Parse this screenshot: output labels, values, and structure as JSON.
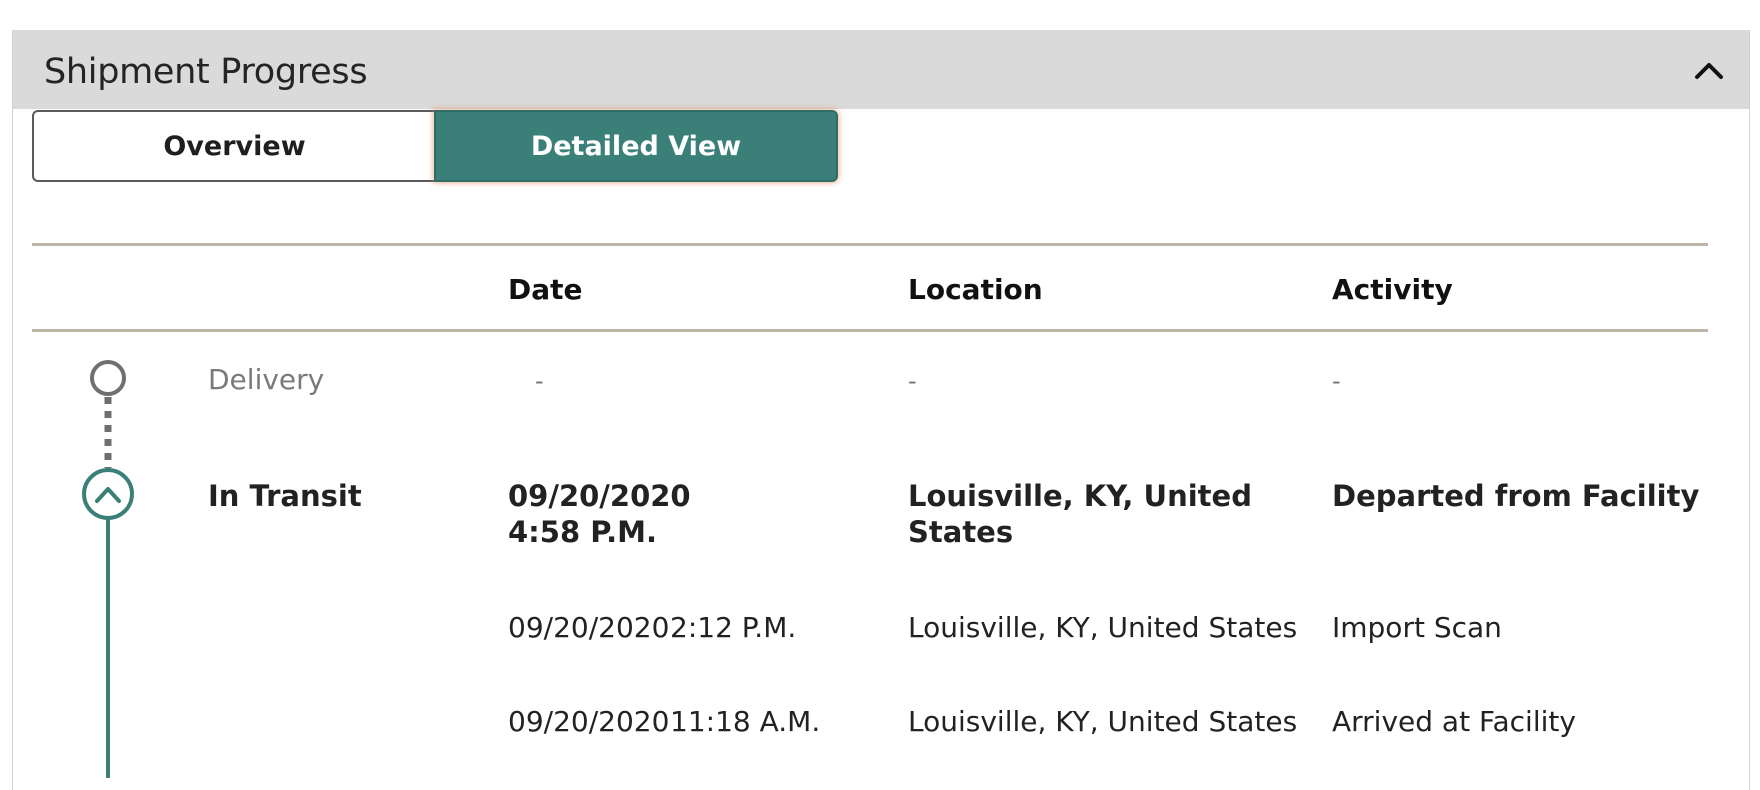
{
  "panel": {
    "title": "Shipment Progress",
    "collapse_icon": "chevron-up-icon"
  },
  "tabs": [
    {
      "label": "Overview",
      "active": false
    },
    {
      "label": "Detailed View",
      "active": true
    }
  ],
  "colors": {
    "accent": "#3a8078",
    "header_bg": "#dadada",
    "rule": "#bdb6a6",
    "pending": "#7a7a7a"
  },
  "table": {
    "headers": {
      "date": "Date",
      "location": "Location",
      "activity": "Activity"
    },
    "milestones": [
      {
        "status": "Delivery",
        "state": "pending",
        "icon": "empty-circle-icon",
        "date": "-",
        "location": "-",
        "activity": "-"
      },
      {
        "status": "In Transit",
        "state": "current",
        "icon": "chevron-up-circle-icon",
        "date_line1": "09/20/2020",
        "date_line2": "4:58 P.M.",
        "location": "Louisville, KY, United States",
        "activity": "Departed from Facility"
      }
    ],
    "events": [
      {
        "date": "09/20/2020",
        "time": "2:12 P.M.",
        "location": "Louisville, KY, United States",
        "activity": "Import Scan"
      },
      {
        "date": "09/20/2020",
        "time": "11:18 A.M.",
        "location": "Louisville, KY, United States",
        "activity": "Arrived at Facility"
      }
    ]
  }
}
